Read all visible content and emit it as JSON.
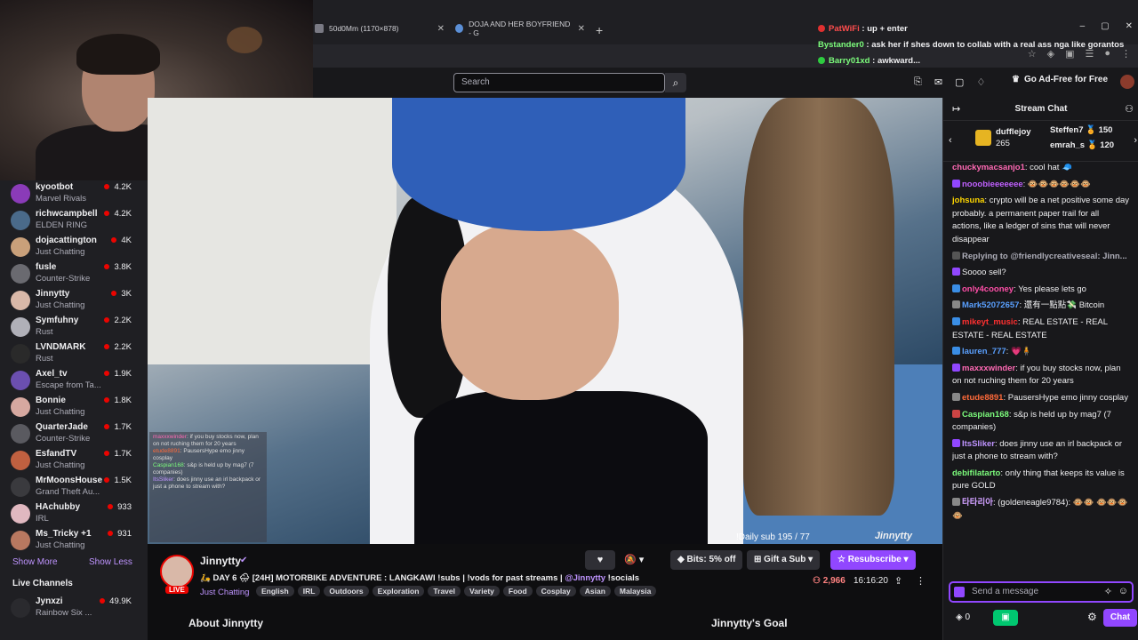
{
  "browser": {
    "tabs": [
      {
        "label": "50d0Mm (1170×878)"
      },
      {
        "label": "DOJA AND HER BOYFRIEND - G"
      }
    ],
    "new_tab": "+",
    "window_controls": [
      "–",
      "▢",
      "✕"
    ]
  },
  "overlay_chat": [
    {
      "user": "PatWiFi",
      "text": "up + enter",
      "color": "#ff4d4d",
      "dot": "#e03030"
    },
    {
      "user": "Bystander0",
      "text": "ask her if shes down to collab with a real ass nga like gorantos",
      "color": "#7cfc7c",
      "dot": ""
    },
    {
      "user": "Barry01xd",
      "text": "awkward...",
      "color": "#7cfc7c",
      "dot": "#2ecc40"
    },
    {
      "user": "Barry01xd",
      "text": "🙂",
      "color": "#7cfc7c",
      "dot": "#2ecc40"
    }
  ],
  "topnav": {
    "search_placeholder": "Search",
    "adfree_label": "Go Ad-Free for Free"
  },
  "sidebar": {
    "channels": [
      {
        "name": "kyootbot",
        "game": "Marvel Rivals",
        "viewers": "4.2K",
        "avatar": "#8a3bb8"
      },
      {
        "name": "richwcampbell",
        "game": "ELDEN RING",
        "viewers": "4.2K",
        "avatar": "#4a6a8a"
      },
      {
        "name": "dojacattington",
        "game": "Just Chatting",
        "viewers": "4K",
        "avatar": "#c9a07a"
      },
      {
        "name": "fusle",
        "game": "Counter-Strike",
        "viewers": "3.8K",
        "avatar": "#6a6a70"
      },
      {
        "name": "Jinnytty",
        "game": "Just Chatting",
        "viewers": "3K",
        "avatar": "#d9b8a8"
      },
      {
        "name": "Symfuhny",
        "game": "Rust",
        "viewers": "2.2K",
        "avatar": "#b0b0b8"
      },
      {
        "name": "LVNDMARK",
        "game": "Rust",
        "viewers": "2.2K",
        "avatar": "#2a2a2a"
      },
      {
        "name": "Axel_tv",
        "game": "Escape from Ta...",
        "viewers": "1.9K",
        "avatar": "#6b4fb0"
      },
      {
        "name": "Bonnie",
        "game": "Just Chatting",
        "viewers": "1.8K",
        "avatar": "#d6a8a0"
      },
      {
        "name": "QuarterJade",
        "game": "Counter-Strike",
        "viewers": "1.7K",
        "avatar": "#5a5a60"
      },
      {
        "name": "EsfandTV",
        "game": "Just Chatting",
        "viewers": "1.7K",
        "avatar": "#c06040"
      },
      {
        "name": "MrMoonsHouse",
        "game": "Grand Theft Au...",
        "viewers": "1.5K",
        "avatar": "#3a3a3e"
      },
      {
        "name": "HAchubby",
        "game": "IRL",
        "viewers": "933",
        "avatar": "#e0b8c0"
      },
      {
        "name": "Ms_Tricky +1",
        "game": "Just Chatting",
        "viewers": "931",
        "avatar": "#b87860"
      }
    ],
    "show_more": "Show More",
    "show_less": "Show Less",
    "live_channels_heading": "Live Channels",
    "live_channels": [
      {
        "name": "Jynxzi",
        "game": "Rainbow Six ...",
        "viewers": "49.9K",
        "avatar": "#2a2a2e"
      }
    ]
  },
  "video": {
    "watermark": "Jinnytty",
    "daily_sub": "!Daily sub 195 / 77"
  },
  "chat": {
    "title": "Stream Chat",
    "gifts": {
      "leader": "dufflejoy",
      "leader_count": "265",
      "second": "Steffen7 🏅 150",
      "third": "emrah_s 🏅 120"
    },
    "messages": [
      {
        "user": "chuckymacsanjo1",
        "color": "#ff69b4",
        "text": "cool hat 🧢",
        "badge": ""
      },
      {
        "user": "nooobieeeeeee",
        "color": "#c060ff",
        "text": "🐵🐵🐵🐵🐵🐵",
        "badge": "#9147ff"
      },
      {
        "user": "johsuna",
        "color": "#ffd700",
        "text": "crypto will be a net positive some day probably. a permanent paper trail for all actions, like a ledger of sins that will never disappear",
        "badge": ""
      },
      {
        "user": "Replying to @friendlycreativeseal: Jinn...",
        "color": "#adadb8",
        "text": "",
        "badge": "#555"
      },
      {
        "user": "",
        "color": "#9147ff",
        "text": "Soooo sell?",
        "badge": "#9147ff"
      },
      {
        "user": "only4cooney",
        "color": "#ff4fa8",
        "text": "Yes please lets go",
        "badge": "#3a8ee6"
      },
      {
        "user": "Mark52072657",
        "color": "#5aa0ff",
        "text": "還有一點點💸 Bitcoin",
        "badge": "#888"
      },
      {
        "user": "mikeyt_music",
        "color": "#ff3030",
        "text": "REAL ESTATE - REAL ESTATE - REAL ESTATE",
        "badge": "#3a8ee6"
      },
      {
        "user": "lauren_777",
        "color": "#5aa0ff",
        "text": "💗🧍",
        "badge": "#3a8ee6"
      },
      {
        "user": "maxxxwinder",
        "color": "#ff69b4",
        "text": "if you buy stocks now, plan on not ruching them for 20 years",
        "badge": "#9147ff"
      },
      {
        "user": "etude8891",
        "color": "#ff6a3a",
        "text": "PausersHype emo jinny cosplay",
        "badge": "#888"
      },
      {
        "user": "Caspian168",
        "color": "#7cfc7c",
        "text": "s&p is held up by mag7 (7 companies)",
        "badge": "#c44"
      },
      {
        "user": "ItsSliker",
        "color": "#bf94ff",
        "text": "does jinny use an irl backpack or just a phone to stream with?",
        "badge": "#9147ff"
      },
      {
        "user": "debifilatarto",
        "color": "#7cfc7c",
        "text": "only thing that keeps its value is pure GOLD",
        "badge": ""
      },
      {
        "user": "타타리아",
        "color": "#d0a0ff",
        "text": "(goldeneagle9784): 🐵🐵 🐵🐵🐵🐵",
        "badge": "#888"
      }
    ],
    "input_placeholder": "Send a message",
    "points": "0",
    "chat_button": "Chat"
  },
  "stream": {
    "channel_name": "Jinnytty",
    "live_badge": "LIVE",
    "title": "🛵 DAY 6 🌧 [24H] MOTORBIKE ADVENTURE : LANGKAWI !subs | !vods for past streams | ",
    "title_mention": "@Jinnytty",
    "title_suffix": " !socials",
    "category": "Just Chatting",
    "tags": [
      "English",
      "IRL",
      "Outdoors",
      "Exploration",
      "Travel",
      "Variety",
      "Food",
      "Cosplay",
      "Asian",
      "Malaysia"
    ],
    "bits_label": "Bits: 5% off",
    "gift_sub_label": "Gift a Sub",
    "resub_label": "Resubscribe",
    "viewers": "2,966",
    "uptime": "16:16:20",
    "about": "About Jinnytty",
    "goal": "Jinnytty's Goal"
  }
}
